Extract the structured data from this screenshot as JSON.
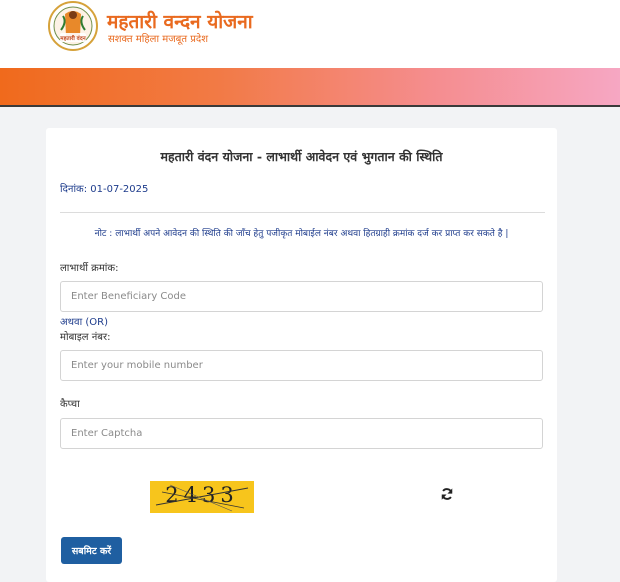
{
  "header": {
    "title": "महतारी वन्दन योजना",
    "subtitle": "सशक्त महिला मजबूत प्रदेश",
    "logo_text": "महतारी वंदन"
  },
  "colors": {
    "brand_orange": "#e96a1f",
    "banner_start": "#f06a1c",
    "banner_end": "#f6a7c3",
    "link_blue": "#1e3c8c",
    "button_blue": "#1f5fa1",
    "captcha_bg": "#f7c51c"
  },
  "form": {
    "title": "महतारी वंदन योजना - लाभार्थी आवेदन एवं भुगतान की स्थिति",
    "date": "दिनांक: 01-07-2025",
    "note": "नोट : लाभार्थी अपने आवेदन की स्थिति की जाँच हेतु पजीकृत मोबाईल नंबर अथवा हितग्राही क्रमांक दर्ज कर प्राप्त कर सकते है |",
    "beneficiary": {
      "label": "लाभार्थी क्रमांक:",
      "placeholder": "Enter Beneficiary Code",
      "value": ""
    },
    "or_label": "अथवा (OR)",
    "mobile": {
      "label": "मोबाइल नंबर:",
      "placeholder": "Enter your mobile number",
      "value": ""
    },
    "captcha": {
      "label": "कैप्चा",
      "placeholder": "Enter Captcha",
      "value": "",
      "image_text": "2433"
    },
    "refresh_icon": "refresh-icon",
    "submit_label": "सबमिट करें"
  }
}
